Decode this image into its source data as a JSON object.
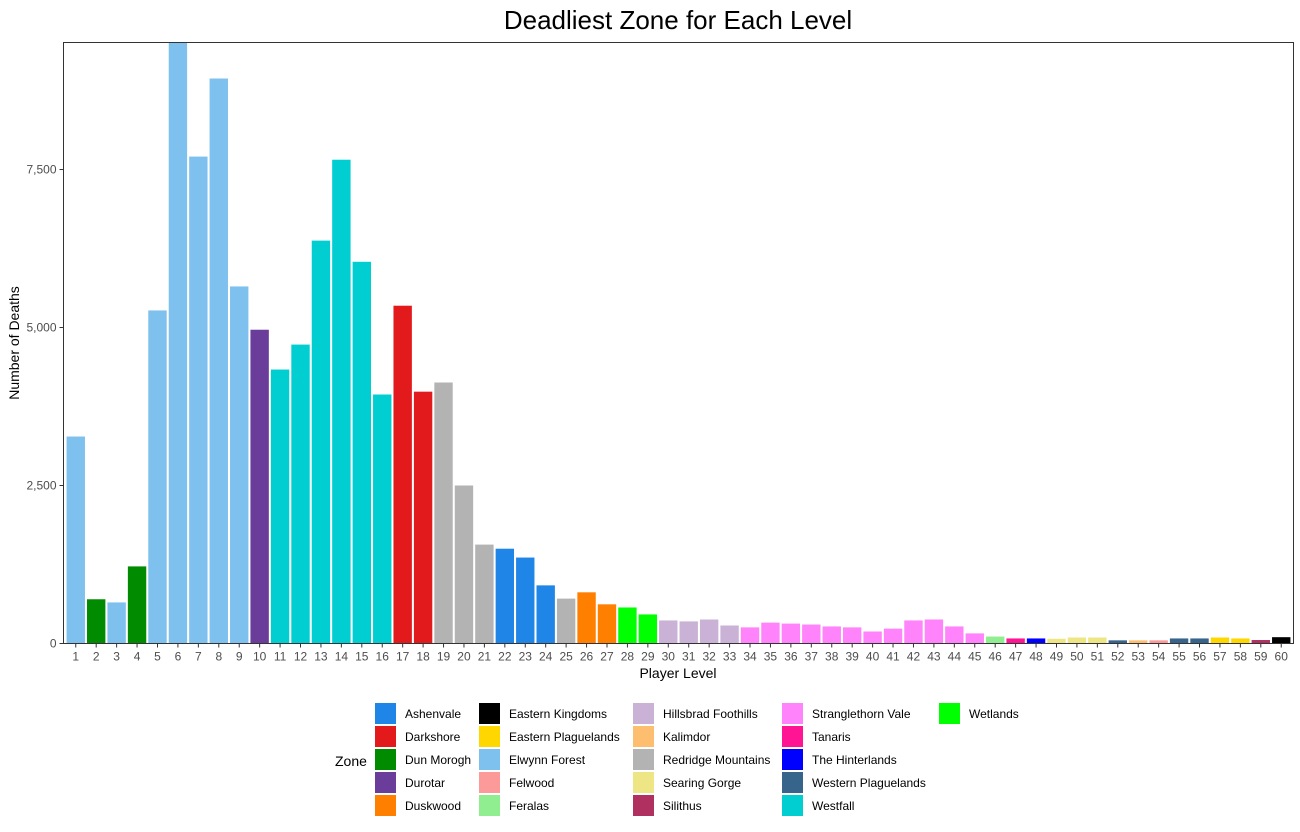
{
  "chart_data": {
    "type": "bar",
    "title": "Deadliest Zone for Each Level",
    "xlabel": "Player Level",
    "ylabel": "Number of Deaths",
    "ylim": [
      0,
      9510
    ],
    "yticks": [
      0,
      2500,
      5000,
      7500
    ],
    "ytick_labels": [
      "0",
      "2,500",
      "5,000",
      "7,500"
    ],
    "grid": false,
    "legend": {
      "title": "Zone",
      "position": "bottom",
      "entries": [
        {
          "name": "Ashenvale",
          "color": "#1f86e8"
        },
        {
          "name": "Darkshore",
          "color": "#e31a1c"
        },
        {
          "name": "Dun Morogh",
          "color": "#008b00"
        },
        {
          "name": "Durotar",
          "color": "#6a3d9a"
        },
        {
          "name": "Duskwood",
          "color": "#ff7f00"
        },
        {
          "name": "Eastern Kingdoms",
          "color": "#000000"
        },
        {
          "name": "Eastern Plaguelands",
          "color": "#ffd700"
        },
        {
          "name": "Elwynn Forest",
          "color": "#7ec0ee"
        },
        {
          "name": "Felwood",
          "color": "#fb9a99"
        },
        {
          "name": "Feralas",
          "color": "#90ee90"
        },
        {
          "name": "Hillsbrad Foothills",
          "color": "#cab2d6"
        },
        {
          "name": "Kalimdor",
          "color": "#fdbf6f"
        },
        {
          "name": "Redridge Mountains",
          "color": "#b3b3b3"
        },
        {
          "name": "Searing Gorge",
          "color": "#eee685"
        },
        {
          "name": "Silithus",
          "color": "#b03060"
        },
        {
          "name": "Stranglethorn Vale",
          "color": "#ff83fa"
        },
        {
          "name": "Tanaris",
          "color": "#ff1493"
        },
        {
          "name": "The Hinterlands",
          "color": "#0000ff"
        },
        {
          "name": "Western Plaguelands",
          "color": "#36648b"
        },
        {
          "name": "Westfall",
          "color": "#00ced1"
        },
        {
          "name": "Wetlands",
          "color": "#00ff00"
        }
      ]
    },
    "categories": [
      "1",
      "2",
      "3",
      "4",
      "5",
      "6",
      "7",
      "8",
      "9",
      "10",
      "11",
      "12",
      "13",
      "14",
      "15",
      "16",
      "17",
      "18",
      "19",
      "20",
      "21",
      "22",
      "23",
      "24",
      "25",
      "26",
      "27",
      "28",
      "29",
      "30",
      "31",
      "32",
      "33",
      "34",
      "35",
      "36",
      "37",
      "38",
      "39",
      "40",
      "41",
      "42",
      "43",
      "44",
      "45",
      "46",
      "47",
      "48",
      "49",
      "50",
      "51",
      "52",
      "53",
      "54",
      "55",
      "56",
      "57",
      "58",
      "59",
      "60"
    ],
    "values": [
      3275,
      700,
      650,
      1220,
      5270,
      9510,
      7705,
      8940,
      5650,
      4965,
      4335,
      4730,
      6375,
      7655,
      6040,
      3940,
      5345,
      3985,
      4130,
      2500,
      1565,
      1500,
      1360,
      920,
      710,
      810,
      620,
      570,
      460,
      365,
      350,
      380,
      285,
      255,
      330,
      315,
      300,
      270,
      255,
      190,
      235,
      365,
      380,
      270,
      160,
      110,
      80,
      80,
      75,
      95,
      95,
      50,
      50,
      50,
      80,
      80,
      95,
      80,
      55,
      100
    ],
    "zones": [
      "Elwynn Forest",
      "Dun Morogh",
      "Elwynn Forest",
      "Dun Morogh",
      "Elwynn Forest",
      "Elwynn Forest",
      "Elwynn Forest",
      "Elwynn Forest",
      "Elwynn Forest",
      "Durotar",
      "Westfall",
      "Westfall",
      "Westfall",
      "Westfall",
      "Westfall",
      "Westfall",
      "Darkshore",
      "Darkshore",
      "Redridge Mountains",
      "Redridge Mountains",
      "Redridge Mountains",
      "Ashenvale",
      "Ashenvale",
      "Ashenvale",
      "Redridge Mountains",
      "Duskwood",
      "Duskwood",
      "Wetlands",
      "Wetlands",
      "Hillsbrad Foothills",
      "Hillsbrad Foothills",
      "Hillsbrad Foothills",
      "Hillsbrad Foothills",
      "Stranglethorn Vale",
      "Stranglethorn Vale",
      "Stranglethorn Vale",
      "Stranglethorn Vale",
      "Stranglethorn Vale",
      "Stranglethorn Vale",
      "Stranglethorn Vale",
      "Stranglethorn Vale",
      "Stranglethorn Vale",
      "Stranglethorn Vale",
      "Stranglethorn Vale",
      "Stranglethorn Vale",
      "Feralas",
      "Tanaris",
      "The Hinterlands",
      "Searing Gorge",
      "Searing Gorge",
      "Searing Gorge",
      "Western Plaguelands",
      "Kalimdor",
      "Felwood",
      "Western Plaguelands",
      "Western Plaguelands",
      "Eastern Plaguelands",
      "Eastern Plaguelands",
      "Silithus",
      "Eastern Kingdoms"
    ]
  }
}
